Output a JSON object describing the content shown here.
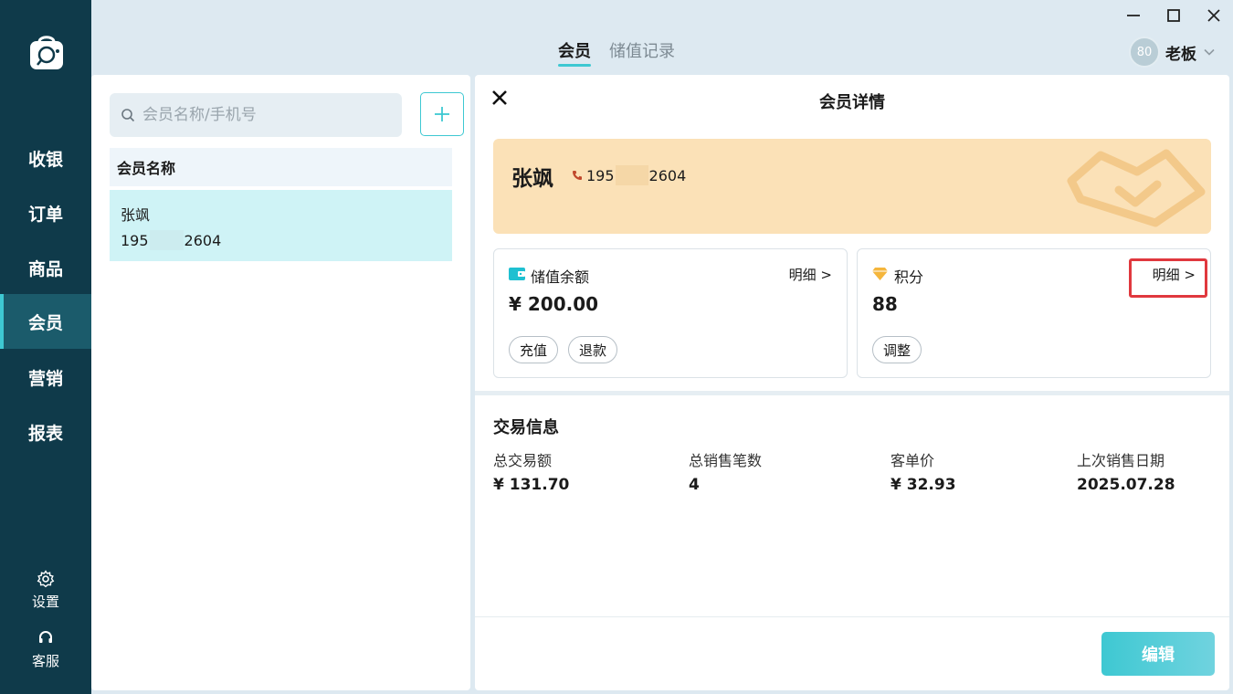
{
  "sidebar": {
    "nav": [
      "收银",
      "订单",
      "商品",
      "会员",
      "营销",
      "报表"
    ],
    "active_index": 3,
    "settings_label": "设置",
    "service_label": "客服"
  },
  "top": {
    "tabs": [
      "会员",
      "储值记录"
    ],
    "active_tab": 0,
    "user": {
      "avatar_text": "80",
      "name": "老板"
    }
  },
  "left": {
    "search_placeholder": "会员名称/手机号",
    "add_icon": "plus-icon",
    "list_header": "会员名称",
    "members": [
      {
        "name": "张飒",
        "phone_prefix": "195",
        "phone_suffix": "2604"
      }
    ]
  },
  "detail": {
    "title": "会员详情",
    "name": "张飒",
    "phone_prefix": "195",
    "phone_suffix": "2604",
    "balance": {
      "label": "储值余额",
      "link": "明细 >",
      "value": "¥ 200.00",
      "buttons": [
        "充值",
        "退款"
      ]
    },
    "points": {
      "label": "积分",
      "link": "明细 >",
      "value": "88",
      "buttons": [
        "调整"
      ]
    },
    "transactions": {
      "title": "交易信息",
      "stats": [
        {
          "label": "总交易额",
          "value": "¥ 131.70"
        },
        {
          "label": "总销售笔数",
          "value": "4"
        },
        {
          "label": "客单价",
          "value": "¥ 32.93"
        },
        {
          "label": "上次销售日期",
          "value": "2025.07.28"
        }
      ]
    },
    "edit_label": "编辑"
  },
  "colors": {
    "sidebar": "#0f3a4a",
    "accent": "#3ec8d2",
    "card": "#fbe1b7",
    "highlight": "#e0383e"
  }
}
